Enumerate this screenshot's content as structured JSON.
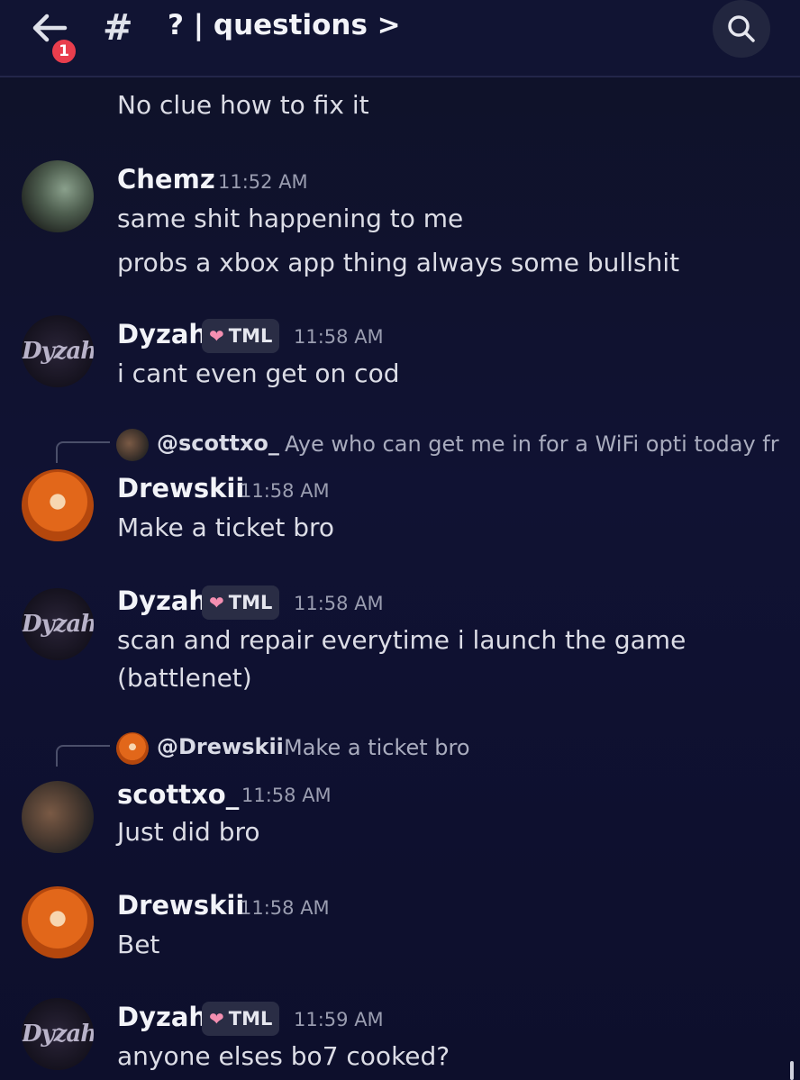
{
  "header": {
    "back_badge": "1",
    "hash": "#",
    "title": "? | questions >"
  },
  "messages": [
    {
      "continuation": "No clue how to fix it"
    },
    {
      "author": "Chemz",
      "time": "11:52 AM",
      "lines": [
        "same shit happening to me",
        "probs a xbox app thing always some bullshit"
      ]
    },
    {
      "author": "Dyzah",
      "tag": "TML",
      "time": "11:58 AM",
      "lines": [
        "i cant even get on cod"
      ]
    },
    {
      "reply_to": "@scottxo_",
      "reply_text": "Aye who can get me in for a WiFi opti today fr",
      "author": "Drewskii",
      "time": "11:58 AM",
      "lines": [
        "Make a ticket bro"
      ]
    },
    {
      "author": "Dyzah",
      "tag": "TML",
      "time": "11:58 AM",
      "lines": [
        "scan and repair everytime i launch the game",
        "(battlenet)"
      ]
    },
    {
      "reply_to": "@Drewskii",
      "reply_text": "Make a ticket bro",
      "author": "scottxo_",
      "time": "11:58 AM",
      "lines": [
        "Just did bro"
      ]
    },
    {
      "author": "Drewskii",
      "time": "11:58 AM",
      "lines": [
        "Bet"
      ]
    },
    {
      "author": "Dyzah",
      "tag": "TML",
      "time": "11:59 AM",
      "lines": [
        "anyone elses bo7 cooked?"
      ]
    }
  ],
  "avatar_logo_text": "Dyzah",
  "colors": {
    "background": "#101233",
    "badge": "#e93e4d",
    "tag_heart": "#f48fb1"
  }
}
